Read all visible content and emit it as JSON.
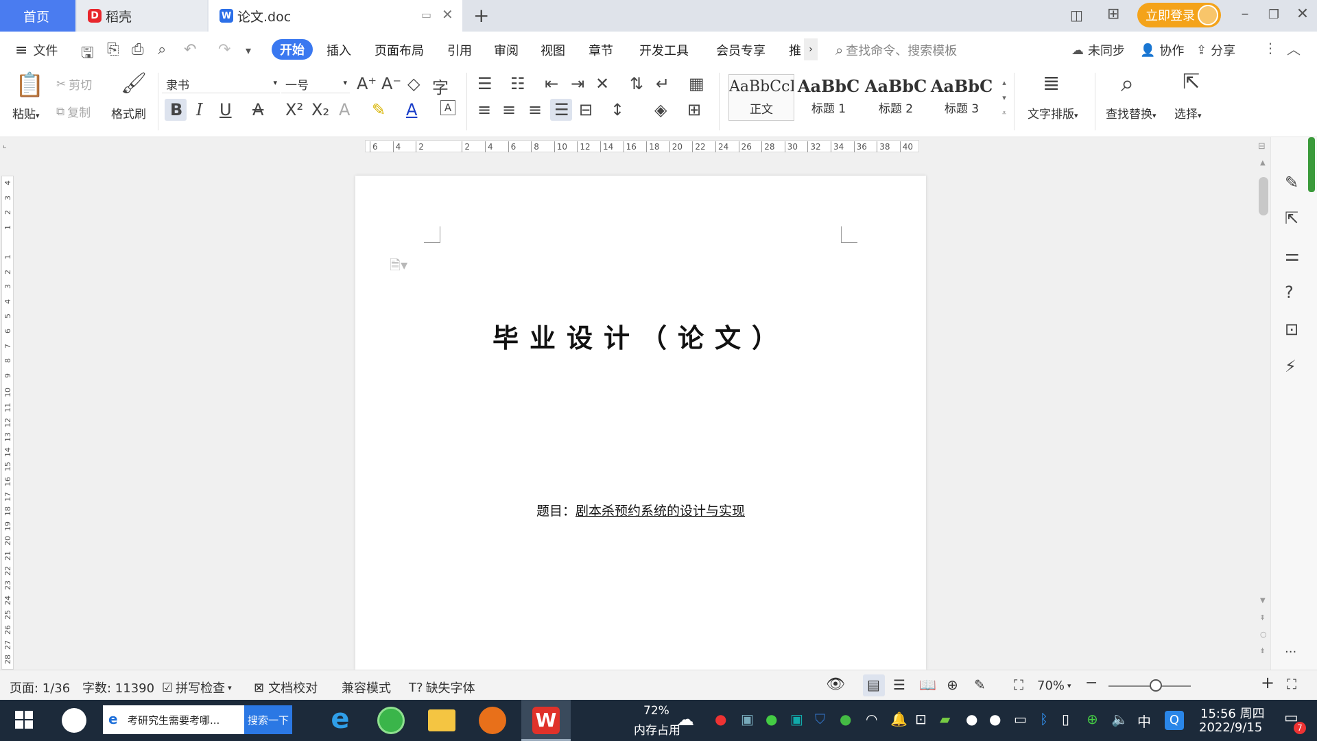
{
  "tabs": {
    "home": "首页",
    "daoke": "稻壳",
    "doc": "论文.doc"
  },
  "titlebar": {
    "login": "立即登录"
  },
  "menu": {
    "file": "文件",
    "start": "开始",
    "insert": "插入",
    "layout": "页面布局",
    "reference": "引用",
    "review": "审阅",
    "view": "视图",
    "chapter": "章节",
    "dev": "开发工具",
    "member": "会员专享",
    "more": "推",
    "search_placeholder": "查找命令、搜索模板",
    "unsync": "未同步",
    "collab": "协作",
    "share": "分享"
  },
  "ribbon": {
    "paste": "粘贴",
    "cut": "剪切",
    "copy": "复制",
    "format_painter": "格式刷",
    "font_name": "隶书",
    "font_size": "一号",
    "styles": [
      {
        "sample": "AaBbCcI",
        "name": "正文"
      },
      {
        "sample": "AaBbC",
        "name": "标题 1"
      },
      {
        "sample": "AaBbC",
        "name": "标题 2"
      },
      {
        "sample": "AaBbC",
        "name": "标题 3"
      }
    ],
    "text_layout": "文字排版",
    "find_replace": "查找替换",
    "select": "选择"
  },
  "ruler": {
    "h_ticks": [
      "6",
      "4",
      "2",
      "",
      "2",
      "4",
      "6",
      "8",
      "10",
      "12",
      "14",
      "16",
      "18",
      "20",
      "22",
      "24",
      "26",
      "28",
      "30",
      "32",
      "34",
      "36",
      "38",
      "40"
    ],
    "v_ticks": [
      "4",
      "3",
      "2",
      "1",
      "",
      "1",
      "2",
      "3",
      "4",
      "5",
      "6",
      "7",
      "8",
      "9",
      "10",
      "11",
      "12",
      "13",
      "14",
      "15",
      "16",
      "17",
      "18",
      "19",
      "20",
      "21",
      "22",
      "23",
      "24",
      "25",
      "26",
      "27",
      "28"
    ]
  },
  "document": {
    "title": "毕业设计（论文）",
    "topic_label": "题目：",
    "topic_value": "剧本杀预约系统的设计与实现"
  },
  "status": {
    "page": "页面: 1/36",
    "words": "字数: 11390",
    "spell": "拼写检查",
    "proof": "文档校对",
    "compat": "兼容模式",
    "missing_font": "缺失字体",
    "zoom": "70%"
  },
  "taskbar": {
    "search_text": "考研究生需要考哪...",
    "search_btn": "搜索一下",
    "mem_percent": "72%",
    "mem_label": "内存占用",
    "ime": "中",
    "time": "15:56 周四",
    "date": "2022/9/15",
    "notif_count": "7"
  }
}
